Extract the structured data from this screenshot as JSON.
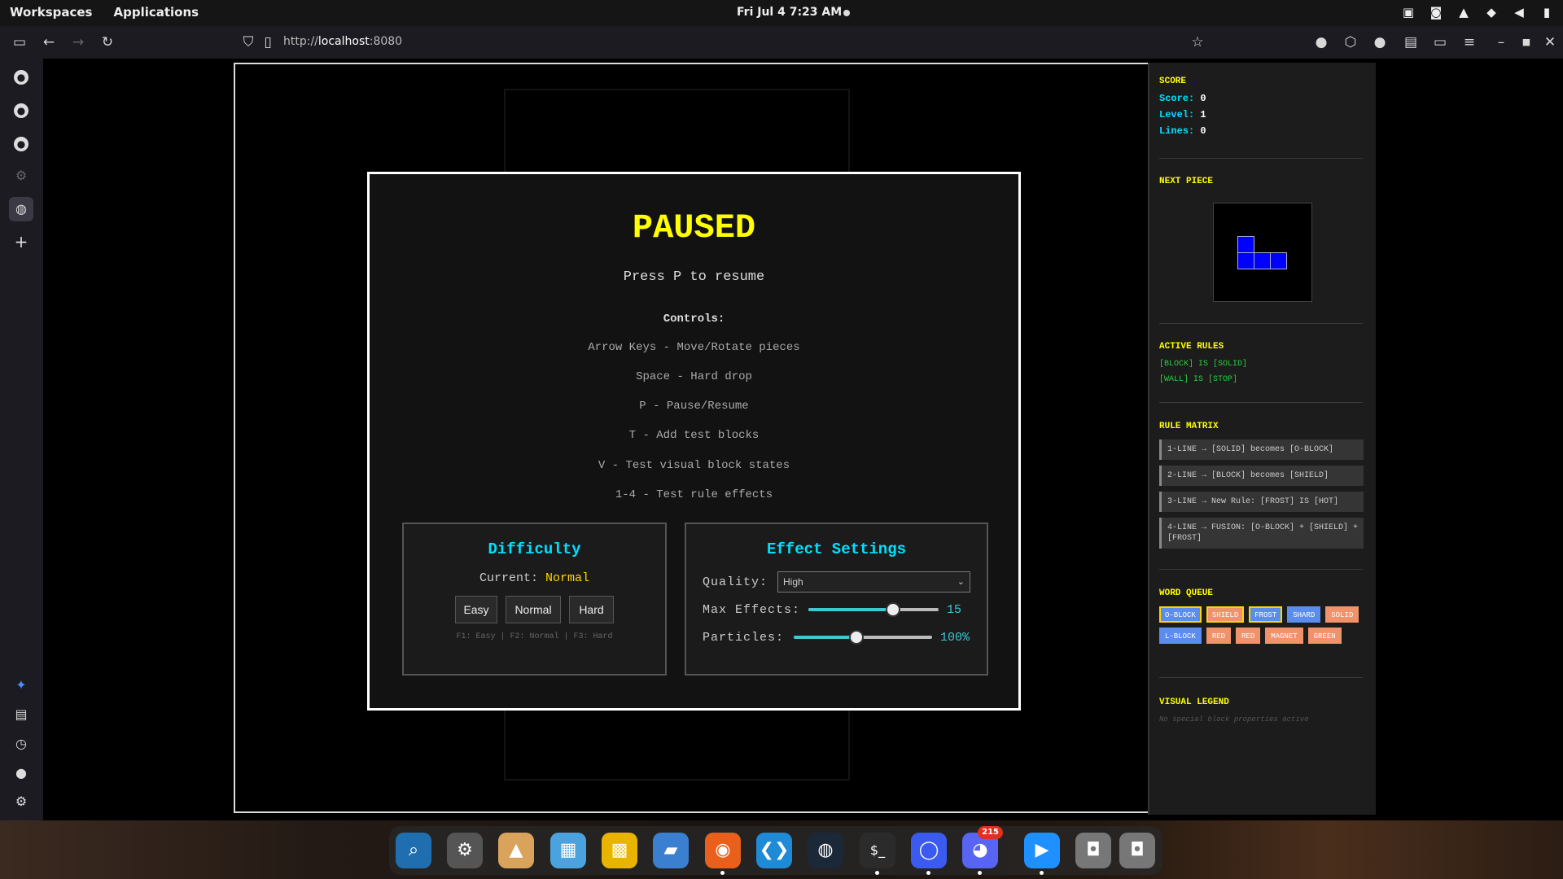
{
  "topbar": {
    "workspaces": "Workspaces",
    "applications": "Applications",
    "clock": "Fri Jul 4  7:23 AM"
  },
  "browser": {
    "url_prefix": "http://",
    "url_host": "localhost",
    "url_suffix": ":8080"
  },
  "game": {
    "pause": {
      "title": "PAUSED",
      "subtitle": "Press P to resume",
      "controls_heading": "Controls:",
      "controls": [
        "Arrow Keys - Move/Rotate pieces",
        "Space - Hard drop",
        "P - Pause/Resume",
        "T - Add test blocks",
        "V - Test visual block states",
        "1-4 - Test rule effects"
      ]
    },
    "difficulty": {
      "heading": "Difficulty",
      "current_label": "Current:",
      "current_value": "Normal",
      "buttons": [
        "Easy",
        "Normal",
        "Hard"
      ],
      "hint": "F1: Easy | F2: Normal | F3: Hard"
    },
    "effects": {
      "heading": "Effect Settings",
      "quality_label": "Quality:",
      "quality_value": "High",
      "max_effects_label": "Max Effects:",
      "max_effects_value": "15",
      "max_effects_fraction": 0.65,
      "particles_label": "Particles:",
      "particles_value": "100%",
      "particles_fraction": 0.45
    },
    "info": {
      "score_heading": "SCORE",
      "score_label": "Score:",
      "score_value": "0",
      "level_label": "Level:",
      "level_value": "1",
      "lines_label": "Lines:",
      "lines_value": "0",
      "next_heading": "NEXT PIECE",
      "rules_heading": "ACTIVE RULES",
      "rules": [
        "[BLOCK] IS [SOLID]",
        "[WALL] IS [STOP]"
      ],
      "matrix_heading": "RULE MATRIX",
      "matrix": [
        "1-LINE → [SOLID] becomes [O-BLOCK]",
        "2-LINE → [BLOCK] becomes [SHIELD]",
        "3-LINE → New Rule: [FROST] IS [HOT]",
        "4-LINE → FUSION: [O-BLOCK] + [SHIELD] + [FROST]"
      ],
      "queue_heading": "WORD QUEUE",
      "queue": [
        {
          "word": "O-BLOCK",
          "color": "blue",
          "selected": true
        },
        {
          "word": "SHIELD",
          "color": "orange",
          "selected": true
        },
        {
          "word": "FROST",
          "color": "blue",
          "selected": true
        },
        {
          "word": "SHARD",
          "color": "blue",
          "selected": false
        },
        {
          "word": "SOLID",
          "color": "orange",
          "selected": false
        },
        {
          "word": "L-BLOCK",
          "color": "blue",
          "selected": false
        },
        {
          "word": "RED",
          "color": "orange",
          "selected": false
        },
        {
          "word": "RED",
          "color": "orange",
          "selected": false
        },
        {
          "word": "MAGNET",
          "color": "orange",
          "selected": false
        },
        {
          "word": "GREEN",
          "color": "orange",
          "selected": false
        }
      ],
      "legend_heading": "VISUAL LEGEND",
      "legend_empty": "No special block properties active"
    }
  },
  "dock": {
    "discord_badge": "215"
  },
  "colors": {
    "accent_yellow": "#ffff00",
    "accent_cyan": "#00e0ff",
    "rule_green": "#2ecc40",
    "piece_blue": "#0000ff"
  }
}
